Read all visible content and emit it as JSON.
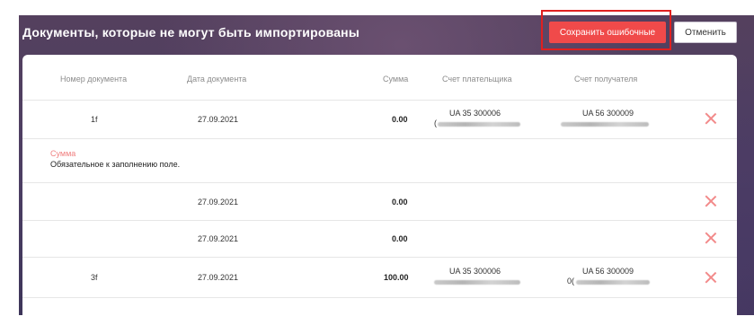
{
  "header": {
    "title": "Документы, которые не могут быть импортированы",
    "save_errors_label": "Сохранить ошибочные",
    "cancel_label": "Отменить"
  },
  "table": {
    "columns": [
      "Номер документа",
      "Дата документа",
      "Сумма",
      "Счет плательщика",
      "Счет получателя"
    ],
    "rows": [
      {
        "number": "1f",
        "date": "27.09.2021",
        "amount": "0.00",
        "payer": "UA 35 300006",
        "payer_prefix": "(",
        "recipient": "UA 56 300009",
        "recipient_prefix": ""
      },
      {
        "number": "",
        "date": "27.09.2021",
        "amount": "0.00",
        "payer": "",
        "payer_prefix": "",
        "recipient": "",
        "recipient_prefix": ""
      },
      {
        "number": "",
        "date": "27.09.2021",
        "amount": "0.00",
        "payer": "",
        "payer_prefix": "",
        "recipient": "",
        "recipient_prefix": ""
      },
      {
        "number": "3f",
        "date": "27.09.2021",
        "amount": "100.00",
        "payer": "UA 35 300006",
        "payer_prefix": "",
        "recipient": "UA 56 300009",
        "recipient_prefix": "0("
      }
    ],
    "error": {
      "field": "Сумма",
      "message": "Обязательное к заполнению поле."
    }
  },
  "colors": {
    "accent": "#f04a4a",
    "highlight_frame": "#e02020",
    "error_label": "#f08080",
    "delete_icon": "#f28a8a"
  },
  "icons": {
    "delete": "close-icon"
  }
}
